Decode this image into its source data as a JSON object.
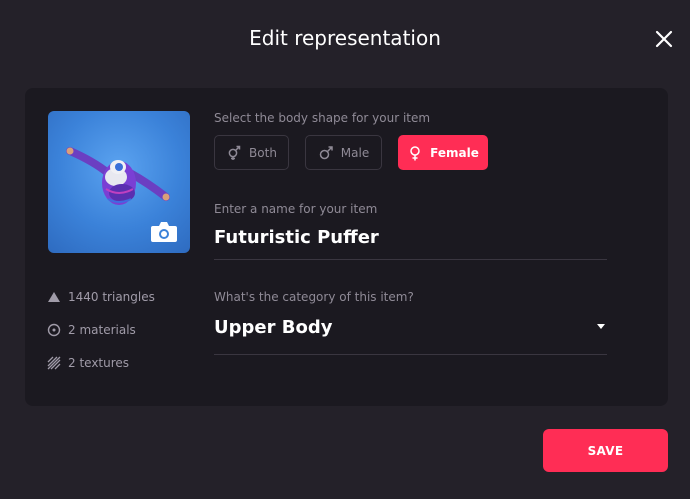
{
  "modal": {
    "title": "Edit representation"
  },
  "stats": [
    {
      "icon": "triangle-icon",
      "text": "1440 triangles"
    },
    {
      "icon": "materials-icon",
      "text": "2 materials"
    },
    {
      "icon": "textures-icon",
      "text": "2 textures"
    }
  ],
  "body_shape": {
    "label": "Select the body shape for your item",
    "options": [
      {
        "label": "Both",
        "selected": false
      },
      {
        "label": "Male",
        "selected": false
      },
      {
        "label": "Female",
        "selected": true
      }
    ]
  },
  "name": {
    "label": "Enter a name for your item",
    "value": "Futuristic Puffer"
  },
  "category": {
    "label": "What's the category of this item?",
    "value": "Upper Body"
  },
  "save_label": "SAVE",
  "colors": {
    "accent": "#ff2d55",
    "background": "#242129",
    "panel": "#1b1920"
  }
}
